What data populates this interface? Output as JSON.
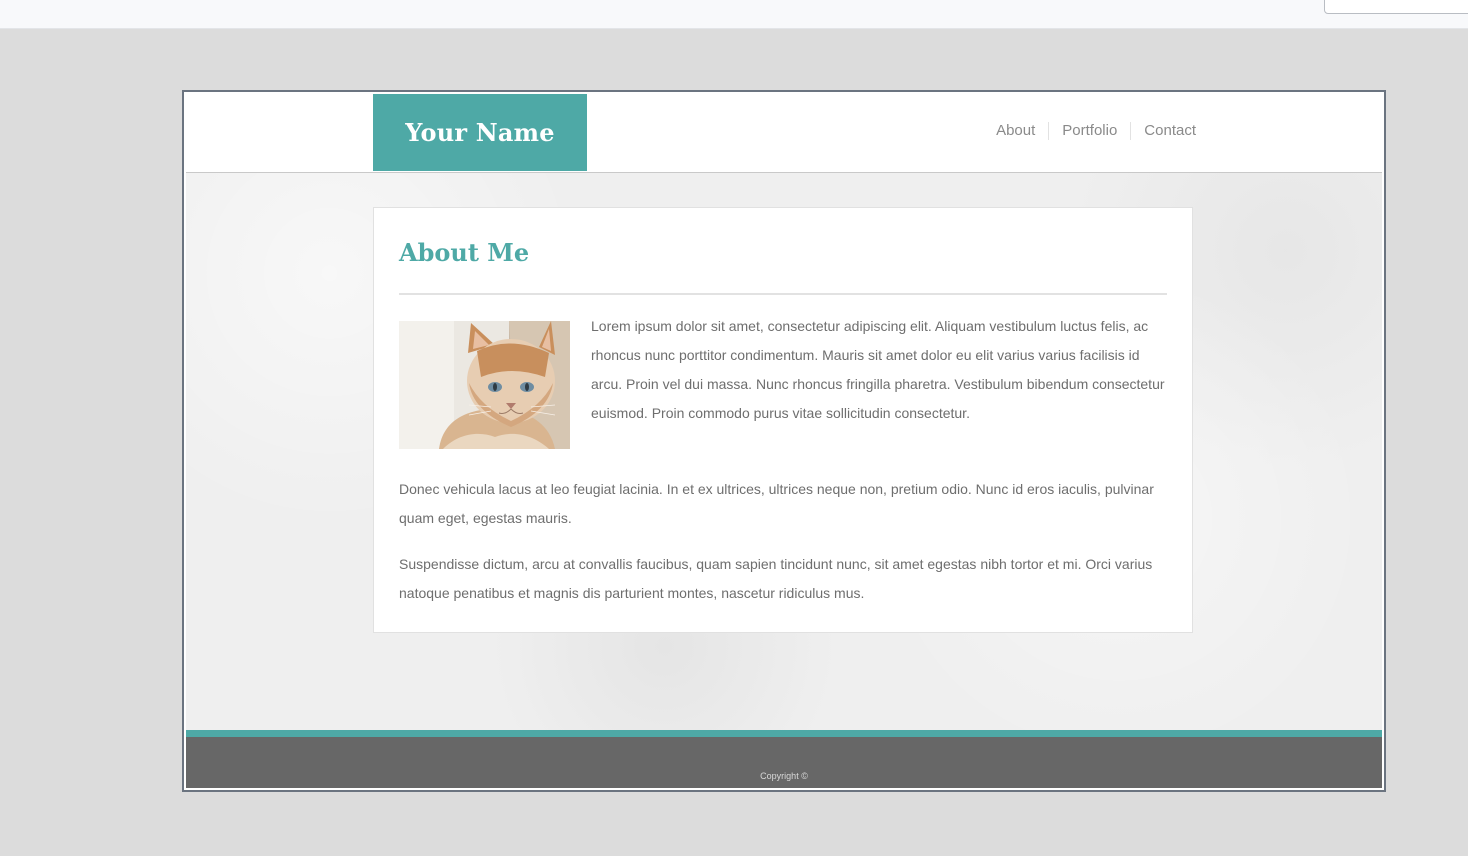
{
  "site": {
    "logo": "Your Name",
    "nav": [
      "About",
      "Portfolio",
      "Contact"
    ]
  },
  "about": {
    "title": "About Me",
    "image": "cat-photo",
    "paragraphs": [
      "Lorem ipsum dolor sit amet, consectetur adipiscing elit. Aliquam vestibulum luctus felis, ac rhoncus nunc porttitor condimentum. Mauris sit amet dolor eu elit varius varius facilisis id arcu. Proin vel dui massa. Nunc rhoncus fringilla pharetra. Vestibulum bibendum consectetur euismod. Proin commodo purus vitae sollicitudin consectetur.",
      "Donec vehicula lacus at leo feugiat lacinia. In et ex ultrices, ultrices neque non, pretium odio. Nunc id eros iaculis, pulvinar quam eget, egestas mauris.",
      "Suspendisse dictum, arcu at convallis faucibus, quam sapien tincidunt nunc, sit amet egestas nibh tortor et mi. Orci varius natoque penatibus et magnis dis parturient montes, nascetur ridiculus mus."
    ]
  },
  "footer": {
    "copyright": "Copyright ©"
  },
  "colors": {
    "accent": "#4ea9a6",
    "footer": "#676767",
    "page_bg": "#dcdcdc",
    "text": "#6e6e6e"
  }
}
